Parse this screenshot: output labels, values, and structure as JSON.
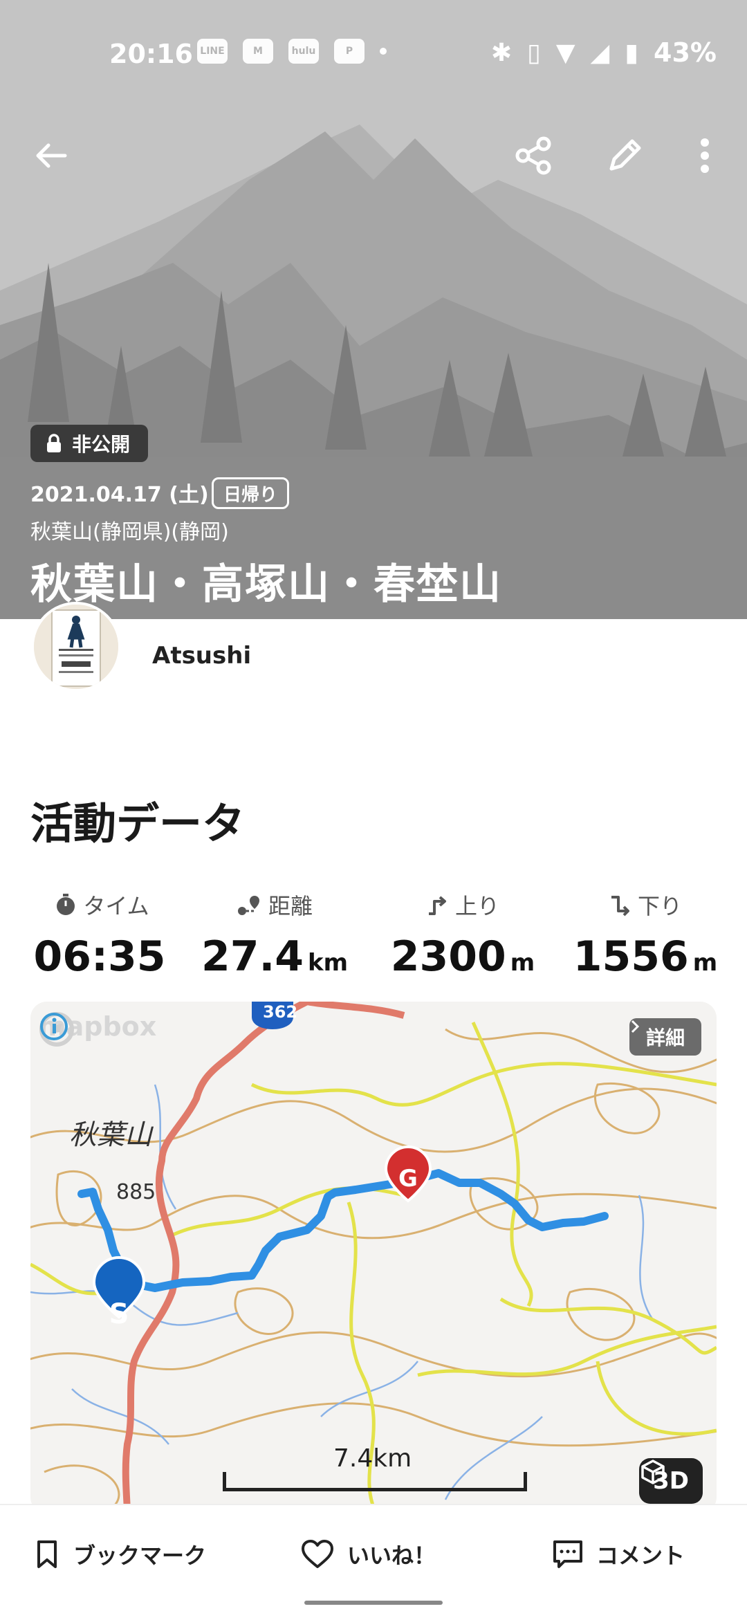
{
  "status_bar": {
    "time": "20:16",
    "apps": [
      "LINE",
      "hulu"
    ],
    "battery": "43%"
  },
  "header": {
    "privacy": "非公開",
    "date": "2021.04.17 (土)",
    "trip_type": "日帰り",
    "area": "秋葉山(静岡県)(静岡)",
    "title": "秋葉山・高塚山・春埜山"
  },
  "user": {
    "name": "Atsushi"
  },
  "activity": {
    "section_title": "活動データ",
    "stats": [
      {
        "label": "タイム",
        "value": "06:35",
        "unit": ""
      },
      {
        "label": "距離",
        "value": "27.4",
        "unit": "km"
      },
      {
        "label": "上り",
        "value": "2300",
        "unit": "m"
      },
      {
        "label": "下り",
        "value": "1556",
        "unit": "m"
      }
    ]
  },
  "map": {
    "attribution": "mapbox",
    "detail_label": "詳細",
    "place_label": "秋葉山",
    "elevation_label": "885",
    "route_badge": "362",
    "start_marker": "S",
    "goal_marker": "G",
    "scale_label": "7.4km",
    "view_3d_label": "3D",
    "colors": {
      "route": "#2f8fe3",
      "main_road": "#e07a6a",
      "minor_road": "#e3e24a",
      "contour": "#d9b070",
      "stream": "#8ab2e6"
    }
  },
  "bottom_bar": {
    "bookmark": "ブックマーク",
    "like": "いいね！",
    "comment": "コメント"
  }
}
